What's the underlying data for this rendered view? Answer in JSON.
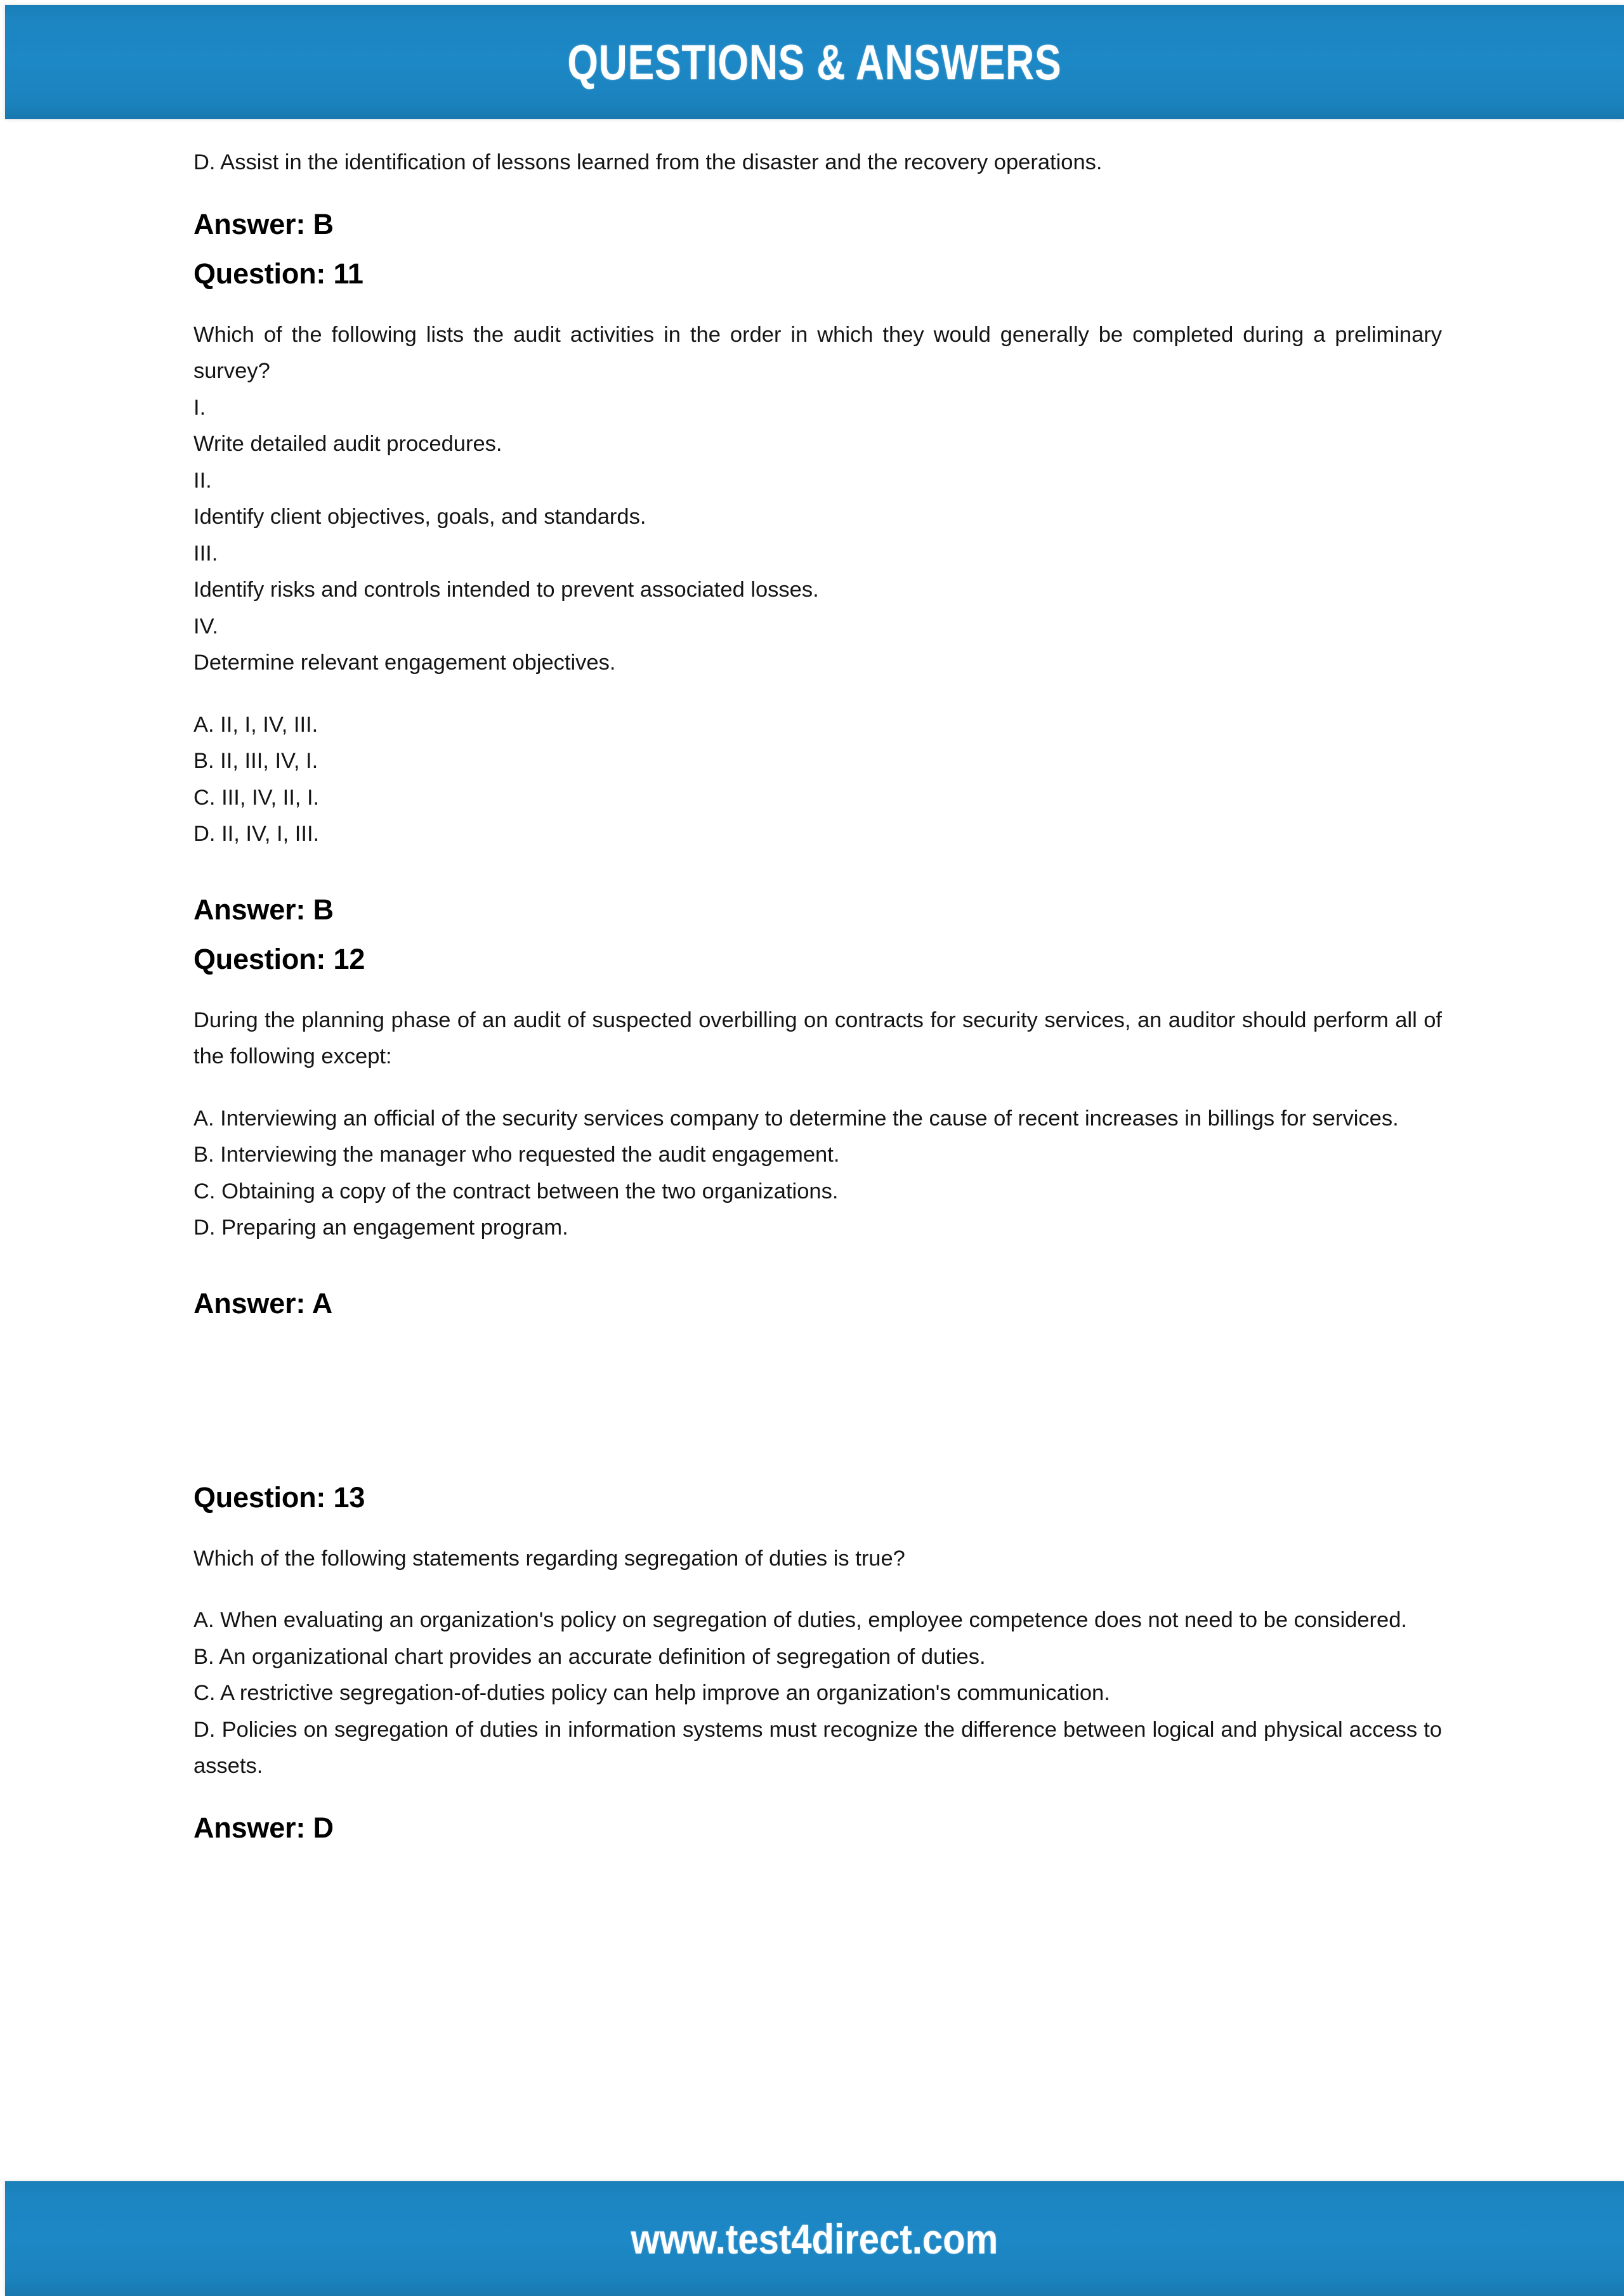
{
  "header": {
    "title": "QUESTIONS & ANSWERS"
  },
  "footer": {
    "url": "www.test4direct.com"
  },
  "document": {
    "prev_question_tail_option": "D. Assist in the identification of lessons learned from the disaster and the recovery operations.",
    "prev_answer_label": "Answer: B",
    "questions": [
      {
        "heading": "Question: 11",
        "stem": "Which of the following lists the audit activities in the order in which they would generally be completed during a preliminary survey?",
        "roman_items": [
          {
            "numeral": "I.",
            "text": "Write detailed audit procedures."
          },
          {
            "numeral": "II.",
            "text": "Identify client objectives, goals, and standards."
          },
          {
            "numeral": "III.",
            "text": "Identify risks and controls intended to prevent associated losses."
          },
          {
            "numeral": "IV.",
            "text": "Determine relevant engagement objectives."
          }
        ],
        "options": [
          "A. II, I, IV, III.",
          "B. II, III, IV, I.",
          "C. III, IV, II, I.",
          "D. II, IV, I, III."
        ],
        "answer_label": "Answer: B"
      },
      {
        "heading": "Question: 12",
        "stem": "During the planning phase of an audit of suspected overbilling on contracts for security services, an auditor should perform all of the following except:",
        "options": [
          "A. Interviewing an official of the security services company to determine the cause of recent increases in billings for services.",
          "B. Interviewing the manager who requested the audit engagement.",
          "C. Obtaining a copy of the contract between the two organizations.",
          "D. Preparing an engagement program."
        ],
        "answer_label": "Answer: A"
      },
      {
        "heading": "Question: 13",
        "stem": "Which of the following statements regarding segregation of duties is true?",
        "options": [
          "A. When evaluating an organization's policy on segregation of duties, employee competence does not need to be considered.",
          "B. An organizational chart provides an accurate definition of segregation of duties.",
          "C. A restrictive segregation-of-duties policy can help improve an organization's communication.",
          "D. Policies on segregation of duties in information systems must recognize the difference between logical and physical access to assets."
        ],
        "answer_label": "Answer: D"
      }
    ]
  },
  "colors": {
    "banner_blue": "#1d88c6",
    "text_black": "#141414"
  }
}
